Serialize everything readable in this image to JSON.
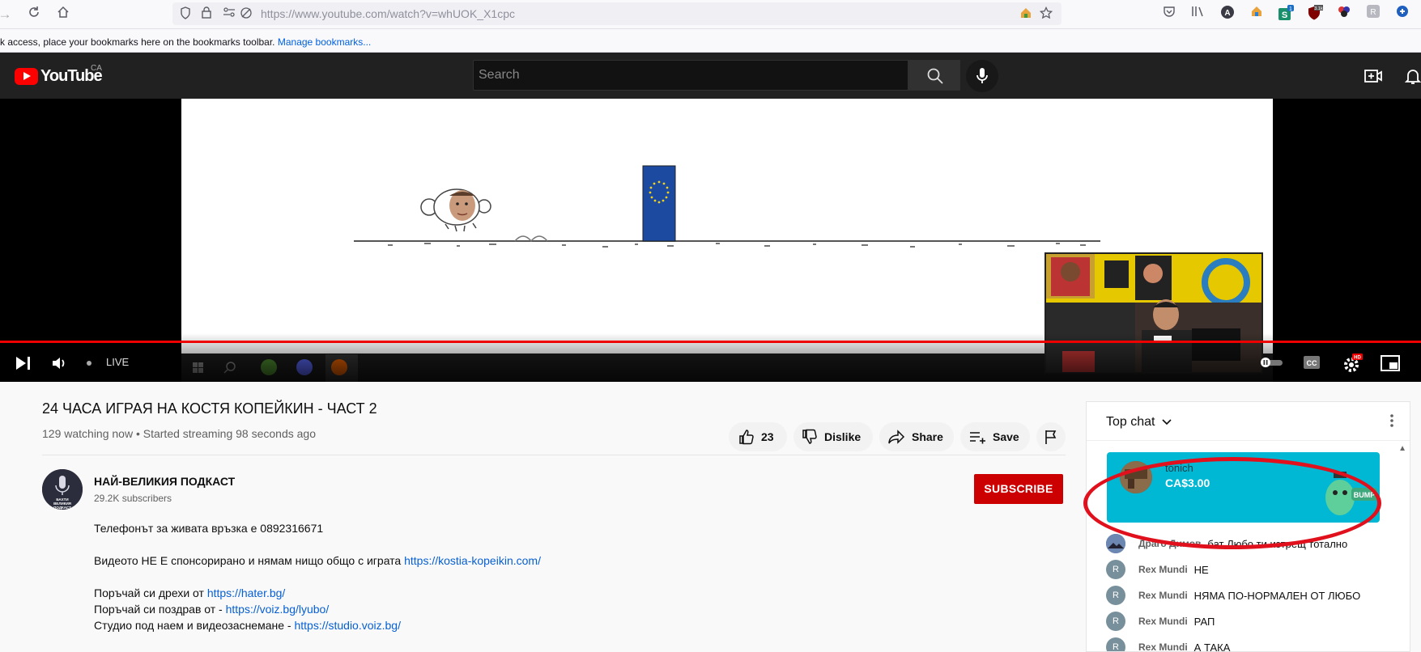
{
  "browser": {
    "url": "https://www.youtube.com/watch?v=whUOK_X1cpc",
    "bookmarks_text": "k access, place your bookmarks here on the bookmarks toolbar.",
    "bookmarks_link": "Manage bookmarks...",
    "badge_count": "1",
    "badge_count2": "3.1k"
  },
  "youtube": {
    "logo_word": "YouTube",
    "country": "CA",
    "search_placeholder": "Search"
  },
  "player": {
    "live_label": "LIVE",
    "hd_badge": "HD"
  },
  "video": {
    "title": "24 ЧАСА ИГРАЯ НА КОСТЯ КОПЕЙКИН - ЧАСТ 2",
    "views_line": "129 watching now • Started streaming 98 seconds ago",
    "like_count": "23",
    "dislike_label": "Dislike",
    "share_label": "Share",
    "save_label": "Save"
  },
  "channel": {
    "name": "НАЙ-ВЕЛИКИЯ ПОДКАСТ",
    "subscribers": "29.2K subscribers",
    "subscribe_label": "SUBSCRIBE",
    "avatar_text": "БАХТИ ВЕЛИКИЯ ПОДКАСТ"
  },
  "description": {
    "line1": "Телефонът за живата връзка е 0892316671",
    "line2_text": "Видеото НЕ Е спонсорирано и нямам нищо общо с играта ",
    "line2_link": "https://kostia-kopeikin.com/",
    "line3_text": "Поръчай си дрехи от ",
    "line3_link": "https://hater.bg/",
    "line4_text": "Поръчай си поздрав от - ",
    "line4_link": "https://voiz.bg/lyubo/",
    "line5_text": "Студио под наем и видеозаснемане - ",
    "line5_link": "https://studio.voiz.bg/"
  },
  "chat": {
    "title": "Top chat",
    "superchat": {
      "name": "tonich",
      "amount": "CA$3.00",
      "sticker_text": "BUMP"
    },
    "messages": [
      {
        "initial": "",
        "author": "Драго Димов",
        "text": "бат Любо ти изтрещ тотално"
      },
      {
        "initial": "R",
        "author": "Rex Mundi",
        "text": "НЕ"
      },
      {
        "initial": "R",
        "author": "Rex Mundi",
        "text": "НЯМА ПО-НОРМАЛЕН ОТ ЛЮБО"
      },
      {
        "initial": "R",
        "author": "Rex Mundi",
        "text": "РАП"
      },
      {
        "initial": "R",
        "author": "Rex Mundi",
        "text": "А ТАКА"
      }
    ]
  },
  "colors": {
    "yt_red": "#ff0000",
    "subscribe_red": "#cc0000",
    "superchat_teal": "#00b8d4",
    "link_blue": "#065fd4",
    "annotation_red": "#e0111c"
  }
}
